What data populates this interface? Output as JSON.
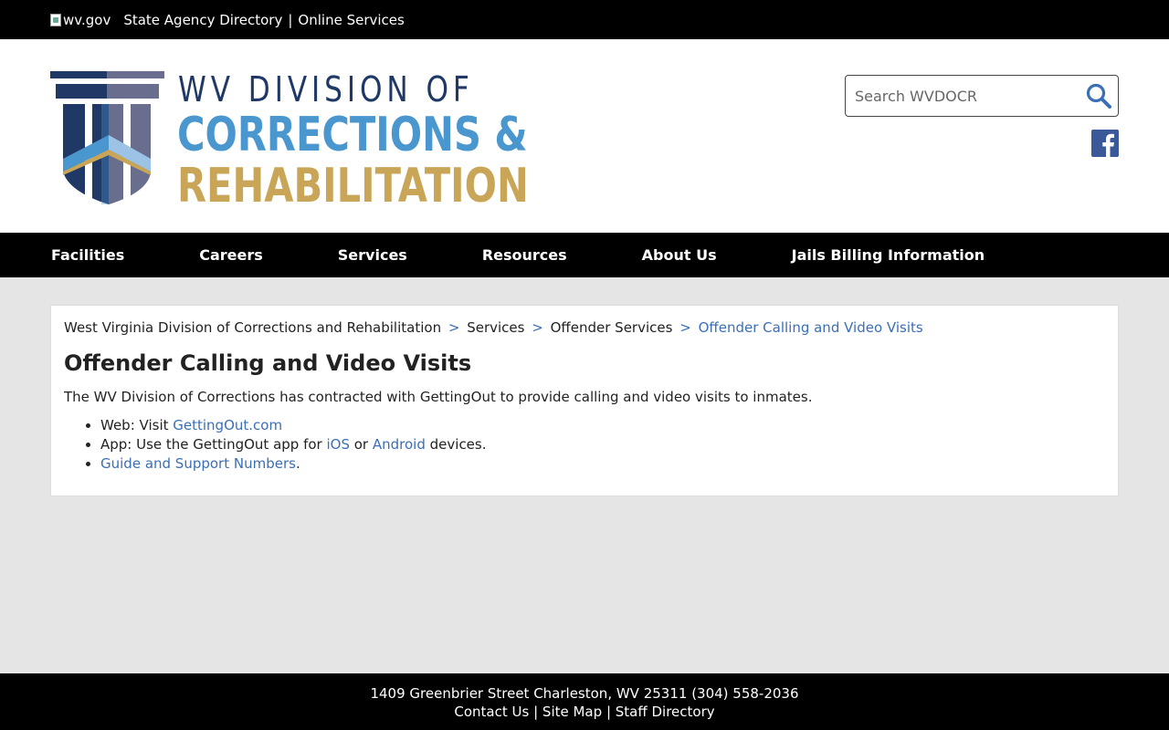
{
  "topbar": {
    "wvgov_alt": "wv.gov",
    "links": [
      "State Agency Directory",
      "Online Services"
    ],
    "separator": "|"
  },
  "logo": {
    "line1": "WV DIVISION OF",
    "line2": "CORRECTIONS &",
    "line3": "REHABILITATION",
    "colors": {
      "navy": "#1f3866",
      "blue": "#4a97cf",
      "gold": "#c9a657"
    }
  },
  "search": {
    "placeholder": "Search WVDOCR",
    "icon": "magnifier-icon"
  },
  "social": {
    "icon": "facebook-icon",
    "color": "#3b5998"
  },
  "nav": {
    "items": [
      "Facilities",
      "Careers",
      "Services",
      "Resources",
      "About Us",
      "Jails Billing Information"
    ]
  },
  "breadcrumb": {
    "items": [
      "West Virginia Division of Corrections and Rehabilitation",
      "Services",
      "Offender Services"
    ],
    "current": "Offender Calling and Video Visits",
    "separator": ">"
  },
  "main": {
    "title": "Offender Calling and Video Visits",
    "intro": "The WV Division of Corrections has contracted with GettingOut to provide calling and video visits to inmates.",
    "bullets": {
      "web_prefix": "Web: Visit ",
      "web_link": "GettingOut.com",
      "app_prefix": "App: Use the GettingOut app for ",
      "app_ios": "iOS",
      "app_or": " or ",
      "app_android": "Android",
      "app_suffix": " devices.",
      "guide_link": "Guide and Support Numbers",
      "guide_suffix": "."
    }
  },
  "footer": {
    "address": "1409 Greenbrier Street Charleston, WV 25311 (304) 558-2036",
    "links": [
      "Contact Us",
      "Site Map",
      "Staff Directory"
    ],
    "separator": "|"
  },
  "colors": {
    "link": "#3a6fb5",
    "bar": "#000000",
    "page_bg": "#e5e5e5"
  }
}
